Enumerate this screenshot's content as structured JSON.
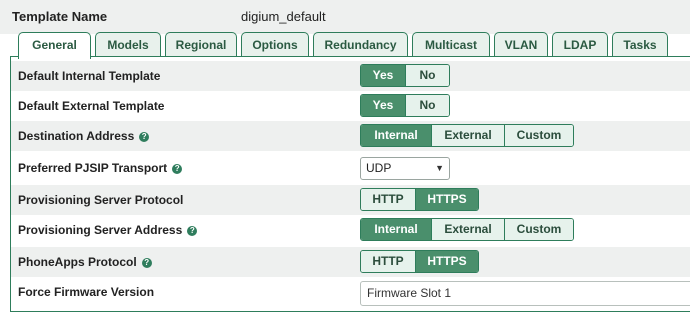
{
  "template": {
    "label": "Template Name",
    "value": "digium_default"
  },
  "tabs": [
    {
      "label": "General",
      "active": true
    },
    {
      "label": "Models"
    },
    {
      "label": "Regional"
    },
    {
      "label": "Options"
    },
    {
      "label": "Redundancy"
    },
    {
      "label": "Multicast"
    },
    {
      "label": "VLAN"
    },
    {
      "label": "LDAP"
    },
    {
      "label": "Tasks"
    }
  ],
  "settings": {
    "default_internal": {
      "label": "Default Internal Template",
      "options": [
        "Yes",
        "No"
      ],
      "selected": "Yes"
    },
    "default_external": {
      "label": "Default External Template",
      "options": [
        "Yes",
        "No"
      ],
      "selected": "Yes"
    },
    "destination_address": {
      "label": "Destination Address",
      "options": [
        "Internal",
        "External",
        "Custom"
      ],
      "selected": "Internal"
    },
    "pjsip_transport": {
      "label": "Preferred PJSIP Transport",
      "value": "UDP"
    },
    "prov_protocol": {
      "label": "Provisioning Server Protocol",
      "options": [
        "HTTP",
        "HTTPS"
      ],
      "selected": "HTTPS"
    },
    "prov_address": {
      "label": "Provisioning Server Address",
      "options": [
        "Internal",
        "External",
        "Custom"
      ],
      "selected": "Internal"
    },
    "phoneapps_protocol": {
      "label": "PhoneApps Protocol",
      "options": [
        "HTTP",
        "HTTPS"
      ],
      "selected": "HTTPS"
    },
    "firmware_version": {
      "label": "Force Firmware Version",
      "value": "Firmware Slot 1"
    }
  },
  "icons": {
    "help": "help-circle-icon",
    "dropdown": "chevron-down-icon"
  },
  "colors": {
    "accent": "#4a8f6c",
    "border": "#2e7d5b",
    "inactive_tab": "#e8f1ec",
    "row_shade": "#eef0ef"
  }
}
